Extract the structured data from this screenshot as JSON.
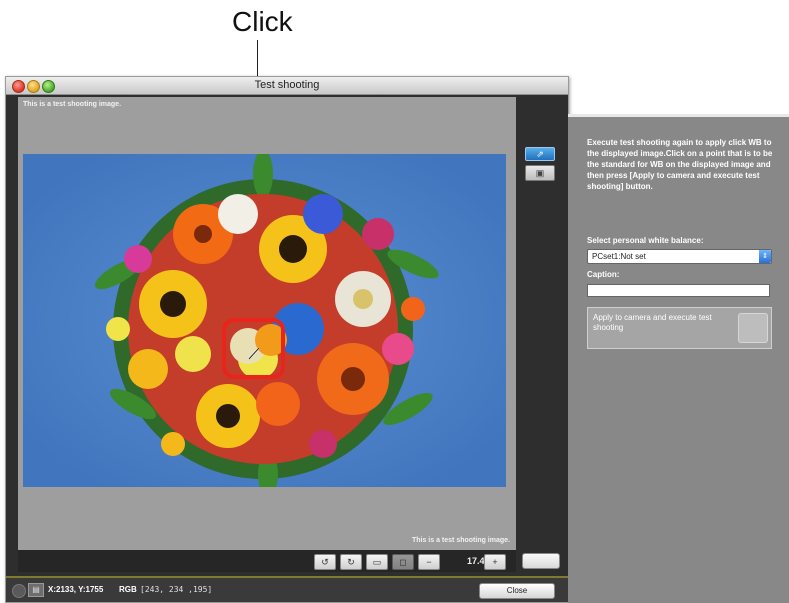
{
  "annotation": {
    "label": "Click"
  },
  "window": {
    "title": "Test shooting",
    "caption_top": "This is a test shooting image.",
    "caption_bottom": "This is a test shooting image."
  },
  "toolbar": {
    "zoom": "17.4%"
  },
  "status": {
    "coords": "X:2133, Y:1755",
    "rgb_label": "RGB",
    "rgb_value": "[243, 234 ,195]"
  },
  "footer": {
    "close_label": "Close"
  },
  "panel": {
    "instructions": "Execute test shooting again to apply click WB to the displayed image.Click on a point that is to be the standard for WB on the displayed image and then press [Apply to camera and execute test shooting] button.",
    "wb_label": "Select personal white balance:",
    "wb_value": "PCset1:Not set",
    "caption_label": "Caption:",
    "caption_value": "",
    "apply_label": "Apply to camera and execute test shooting"
  },
  "colors": {
    "highlight": "#e8251c",
    "backdrop": "#4f83c8",
    "panel": "#888888"
  }
}
